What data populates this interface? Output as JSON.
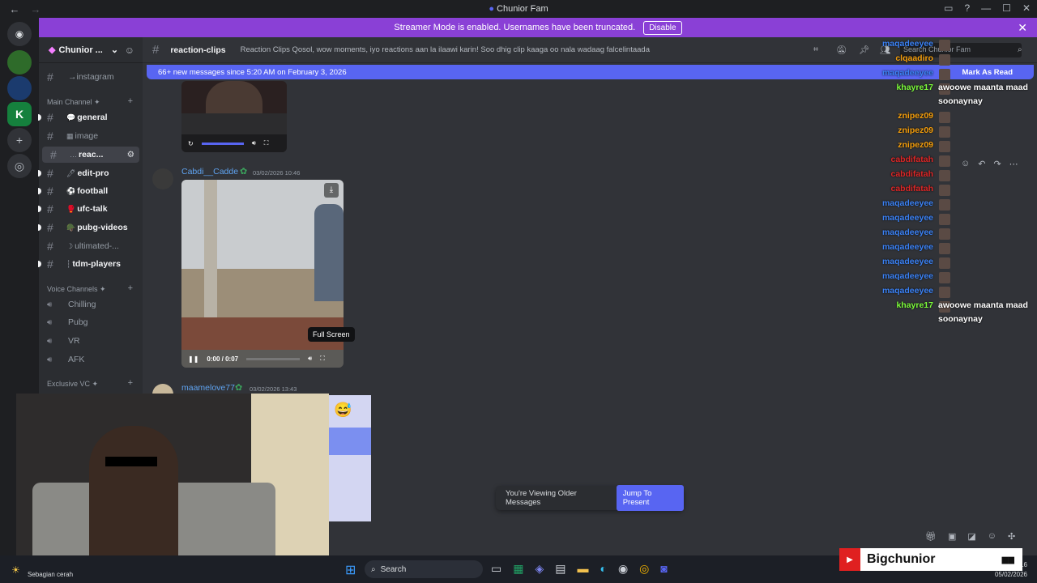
{
  "window": {
    "title": "Chunior Fam",
    "back": "←",
    "forward": "→"
  },
  "banner": {
    "text": "Streamer Mode is enabled. Usernames have been truncated.",
    "disable": "Disable"
  },
  "server": {
    "name": "Chunior ..."
  },
  "channels": {
    "top": "→instagram",
    "main_category": "Main Channel ✦",
    "items": [
      {
        "label": "general",
        "bold": true
      },
      {
        "label": "image",
        "bold": false
      },
      {
        "label": "reac...",
        "bold": true
      },
      {
        "label": "edit-pro",
        "bold": true
      },
      {
        "label": "football",
        "bold": true
      },
      {
        "label": "ufc-talk",
        "bold": true
      },
      {
        "label": "pubg-videos",
        "bold": true
      },
      {
        "label": "ultimated-...",
        "bold": false
      },
      {
        "label": "tdm-players",
        "bold": true
      }
    ],
    "voice_category": "Voice Channels ✦",
    "voice": [
      "Chilling",
      "Pubg",
      "VR",
      "AFK"
    ],
    "exclusive_category": "Exclusive VC ✦"
  },
  "header": {
    "channel": "reaction-clips",
    "topic": "Reaction Clips Qosol, wow moments, iyo reactions aan la ilaawi karin! Soo dhig clip kaaga oo nala wadaag falcelintaada",
    "search_placeholder": "Search Chunior Fam"
  },
  "new_messages": {
    "text": "66+ new messages since 5:20 AM on February 3, 2026",
    "mark_read": "Mark As Read"
  },
  "messages": [
    {
      "author": "Cabdi__Cadde",
      "time": "03/02/2026 10:46",
      "video_time": "0:00 / 0:07"
    },
    {
      "author": "maamelove77",
      "time": "03/02/2026 13:43"
    }
  ],
  "tooltip": "Full Screen",
  "older": {
    "text": "You're Viewing Older Messages",
    "button": "Jump To Present"
  },
  "overlay": [
    {
      "name": "maqadeeyee",
      "color": "#3b82f6",
      "msg": ""
    },
    {
      "name": "clqaadiro",
      "color": "#f59e0b",
      "msg": ""
    },
    {
      "name": "maqadeeyee",
      "color": "#3b82f6",
      "msg": ""
    },
    {
      "name": "khayre17",
      "color": "#7cfc3a",
      "msg": "awoowe maanta maad"
    },
    {
      "name": "",
      "color": "#ffffff",
      "msg": "soonaynay"
    },
    {
      "name": "znipez09",
      "color": "#f59e0b",
      "msg": ""
    },
    {
      "name": "znipez09",
      "color": "#f59e0b",
      "msg": ""
    },
    {
      "name": "znipez09",
      "color": "#f59e0b",
      "msg": ""
    },
    {
      "name": "cabdifatah",
      "color": "#dc2626",
      "msg": ""
    },
    {
      "name": "cabdifatah",
      "color": "#dc2626",
      "msg": ""
    },
    {
      "name": "cabdifatah",
      "color": "#dc2626",
      "msg": ""
    },
    {
      "name": "maqadeeyee",
      "color": "#3b82f6",
      "msg": ""
    },
    {
      "name": "maqadeeyee",
      "color": "#3b82f6",
      "msg": ""
    },
    {
      "name": "maqadeeyee",
      "color": "#3b82f6",
      "msg": ""
    },
    {
      "name": "maqadeeyee",
      "color": "#3b82f6",
      "msg": ""
    },
    {
      "name": "maqadeeyee",
      "color": "#3b82f6",
      "msg": ""
    },
    {
      "name": "maqadeeyee",
      "color": "#3b82f6",
      "msg": ""
    },
    {
      "name": "maqadeeyee",
      "color": "#3b82f6",
      "msg": ""
    },
    {
      "name": "khayre17",
      "color": "#7cfc3a",
      "msg": "awoowe maanta maad"
    },
    {
      "name": "",
      "color": "#ffffff",
      "msg": "soonaynay"
    }
  ],
  "taskbar": {
    "weather": "Sebagian cerah",
    "search": "Search",
    "date": "05/02/2026",
    "time": "16"
  },
  "youtube": {
    "channel": "Bigchunior"
  },
  "colors": {
    "accent": "#5865f2",
    "banner": "#8a40d6",
    "bg": "#313338"
  }
}
